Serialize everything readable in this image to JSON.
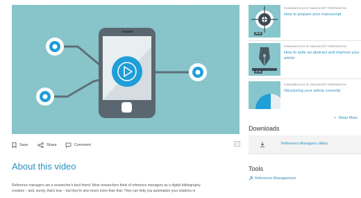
{
  "video": {
    "play_icon": "play-icon",
    "colors": {
      "background": "#86c4c9",
      "accent": "#1f9ed8",
      "phone": "#5b6770"
    }
  },
  "actions": {
    "save": "Save",
    "share": "Share",
    "comment": "Comment"
  },
  "about": {
    "title": "About this video",
    "description_lines": [
      "Reference managers are a researcher's best friend. Most researchers think of reference managers as a digital bibliography",
      "creators – and, surely, that's true – but they're also much more than that.  They can help you automatize your citations in"
    ]
  },
  "related": [
    {
      "series": "FUNDAMENTALS OF MANUSCRIPT PREPARATION",
      "title": "How to prepare your manuscript",
      "duration": "49 M",
      "icon": "target-icon"
    },
    {
      "series": "FUNDAMENTALS OF MANUSCRIPT PREPARATION",
      "title": "How to write an abstract and improve your article",
      "duration": "47 M",
      "icon": "pen-nib-icon"
    },
    {
      "series": "FUNDAMENTALS OF MANUSCRIPT PREPARATION",
      "title": "Structuring your article correctly",
      "duration": "",
      "icon": "pie-chart-icon"
    }
  ],
  "show_more": "Show More",
  "downloads": {
    "heading": "Downloads",
    "items": [
      {
        "label": "Reference Managers slides",
        "icon": "download-icon"
      }
    ]
  },
  "tools": {
    "heading": "Tools",
    "items": [
      {
        "label": "Reference Management",
        "icon": "external-arrow-icon"
      }
    ]
  }
}
